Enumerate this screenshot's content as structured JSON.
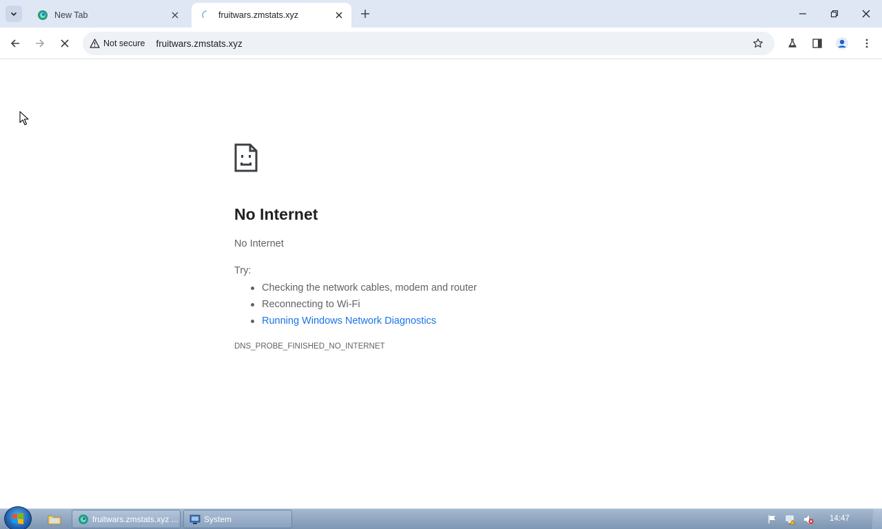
{
  "tabs": {
    "inactive": {
      "title": "New Tab"
    },
    "active": {
      "title": "fruitwars.zmstats.xyz"
    }
  },
  "toolbar": {
    "security_chip": "Not secure",
    "url": "fruitwars.zmstats.xyz"
  },
  "error_page": {
    "title": "No Internet",
    "subtitle": "No Internet",
    "try_label": "Try:",
    "suggestions": [
      "Checking the network cables, modem and router",
      "Reconnecting to Wi-Fi",
      "Running Windows Network Diagnostics"
    ],
    "error_code": "DNS_PROBE_FINISHED_NO_INTERNET"
  },
  "taskbar": {
    "buttons": [
      {
        "label": "fruitwars.zmstats.xyz ..."
      },
      {
        "label": "System"
      }
    ],
    "clock": "14:47"
  },
  "colors": {
    "tabstrip": "#dfe6f4",
    "omnibox": "#eef1f6",
    "link": "#1a73e8",
    "text_secondary": "#5f6368"
  }
}
